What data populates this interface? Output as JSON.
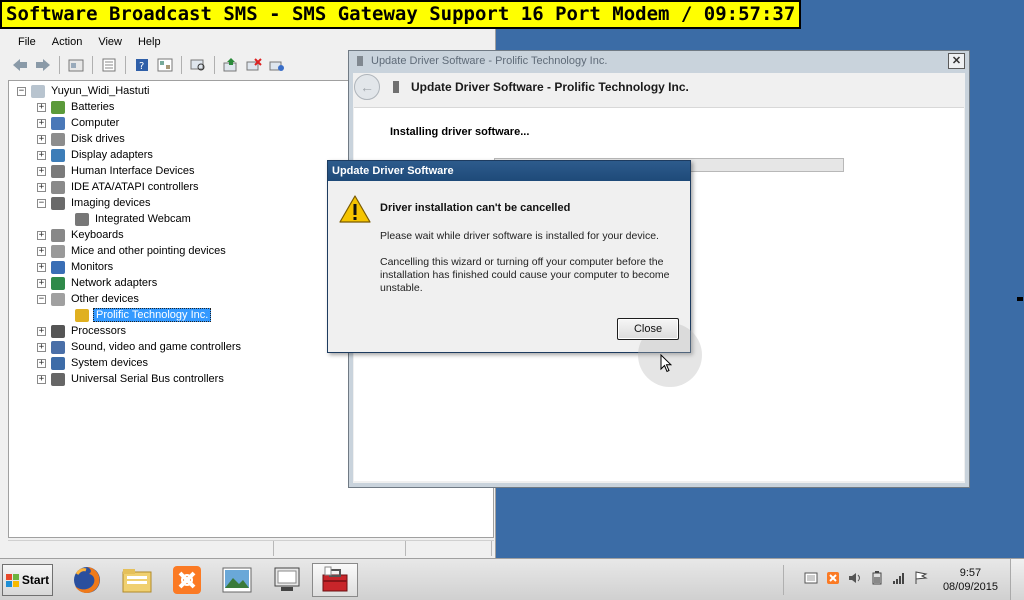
{
  "banner": {
    "text": "Software Broadcast SMS - SMS Gateway Support 16 Port Modem / 09:57:37"
  },
  "device_manager": {
    "menu": [
      "File",
      "Action",
      "View",
      "Help"
    ],
    "toolbar_icons": [
      "back-icon",
      "forward-icon",
      "up-icon",
      "properties-icon",
      "help-icon",
      "show-hide-icon",
      "scan-icon",
      "update-driver-icon",
      "uninstall-icon",
      "disable-icon"
    ],
    "tree": {
      "root": "Yuyun_Widi_Hastuti",
      "items": [
        {
          "label": "Batteries",
          "icon": "battery-icon",
          "expanded": false
        },
        {
          "label": "Computer",
          "icon": "computer-icon",
          "expanded": false
        },
        {
          "label": "Disk drives",
          "icon": "disk-icon",
          "expanded": false
        },
        {
          "label": "Display adapters",
          "icon": "display-icon",
          "expanded": false
        },
        {
          "label": "Human Interface Devices",
          "icon": "hid-icon",
          "expanded": false
        },
        {
          "label": "IDE ATA/ATAPI controllers",
          "icon": "ide-icon",
          "expanded": false
        },
        {
          "label": "Imaging devices",
          "icon": "camera-icon",
          "expanded": true
        },
        {
          "label": "Integrated Webcam",
          "icon": "webcam-icon",
          "child": true
        },
        {
          "label": "Keyboards",
          "icon": "keyboard-icon",
          "expanded": false
        },
        {
          "label": "Mice and other pointing devices",
          "icon": "mouse-icon",
          "expanded": false
        },
        {
          "label": "Monitors",
          "icon": "monitor-icon",
          "expanded": false
        },
        {
          "label": "Network adapters",
          "icon": "network-icon",
          "expanded": false
        },
        {
          "label": "Other devices",
          "icon": "unknown-device-icon",
          "expanded": true
        },
        {
          "label": "Prolific Technology Inc.",
          "icon": "warning-device-icon",
          "child": true,
          "selected": true
        },
        {
          "label": "Processors",
          "icon": "processor-icon",
          "expanded": false
        },
        {
          "label": "Sound, video and game controllers",
          "icon": "sound-icon",
          "expanded": false
        },
        {
          "label": "System devices",
          "icon": "system-icon",
          "expanded": false
        },
        {
          "label": "Universal Serial Bus controllers",
          "icon": "usb-icon",
          "expanded": false
        }
      ]
    }
  },
  "wizard": {
    "window_title": "Update Driver Software - Prolific Technology Inc.",
    "header_title": "Update Driver Software - Prolific Technology Inc.",
    "close_glyph": "✕",
    "back_glyph": "←",
    "status": "Installing driver software...",
    "progress": 0.13
  },
  "dialog": {
    "title": "Update Driver Software",
    "heading": "Driver installation can't be cancelled",
    "message1": "Please wait while driver software is installed for your device.",
    "message2": "Cancelling this wizard or turning off your computer before the installation has finished could cause your computer to become unstable.",
    "close_button": "Close"
  },
  "taskbar": {
    "start_label": "Start",
    "apps": [
      {
        "name": "firefox-icon",
        "active": false
      },
      {
        "name": "file-explorer-icon",
        "active": false
      },
      {
        "name": "xampp-icon",
        "active": false
      },
      {
        "name": "picture-viewer-icon",
        "active": false
      },
      {
        "name": "device-icon",
        "active": false
      },
      {
        "name": "toolbox-icon",
        "active": true
      }
    ],
    "tray_icons": [
      "media-icon",
      "xampp-tray-icon",
      "volume-icon",
      "battery-tray-icon",
      "signal-icon",
      "flag-icon"
    ],
    "clock_time": "9:57",
    "clock_date": "08/09/2015"
  },
  "colors": {
    "desktop": "#3b6ca6",
    "banner": "#ffff00",
    "selection": "#3399ff",
    "dialog_title": "#2d5b8c",
    "progress": "#2a7ad5"
  }
}
